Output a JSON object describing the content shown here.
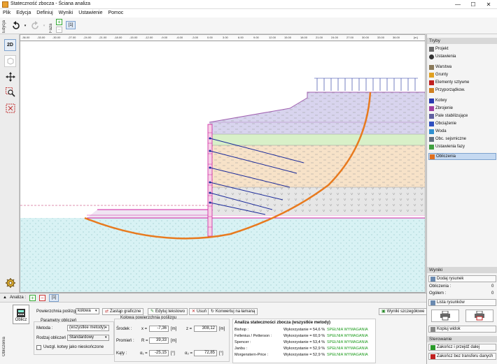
{
  "window": {
    "title": "Stateczność zbocza - Ściana analiza",
    "minimize": "—",
    "maximize": "☐",
    "close": "✕"
  },
  "menu": [
    "Plik",
    "Edycja",
    "Definiuj",
    "Wyniki",
    "Ustawienie",
    "Pomoc"
  ],
  "toolbar": {
    "edit_tab": "Edycja",
    "stage_tab": "Faza",
    "stage_label": "[1]"
  },
  "left_tools": {
    "view_2d": "2D"
  },
  "ruler": {
    "ticks": [
      "-36.00",
      "-33.00",
      "-30.00",
      "-27.00",
      "-24.00",
      "-21.00",
      "-18.00",
      "-15.00",
      "-12.00",
      "-9.00",
      "-6.00",
      "-3.00",
      "0.00",
      "3.00",
      "6.00",
      "9.00",
      "12.00",
      "15.00",
      "18.00",
      "21.00",
      "24.00",
      "27.00",
      "30.00",
      "33.00",
      "36.00",
      "[m]"
    ]
  },
  "modes": {
    "header": "Tryby",
    "items": [
      {
        "label": "Projekt",
        "icon": "project-icon",
        "color": "#6b6b6b"
      },
      {
        "label": "Ustawienia",
        "icon": "settings-icon",
        "color": "#333333"
      },
      {
        "label": "Warstwa",
        "icon": "layer-icon",
        "color": "#8a7a5a"
      },
      {
        "label": "Grunty",
        "icon": "soil-icon",
        "color": "#e0a020"
      },
      {
        "label": "Elementy sztywne",
        "icon": "rigid-icon",
        "color": "#c02020"
      },
      {
        "label": "Przyporządkow.",
        "icon": "assign-icon",
        "color": "#d08020"
      },
      {
        "label": "Kotwy",
        "icon": "anchor-icon",
        "color": "#2a3ab0"
      },
      {
        "label": "Zbrojenie",
        "icon": "reinforcement-icon",
        "color": "#a040a0"
      },
      {
        "label": "Pale stabilizujące",
        "icon": "pile-icon",
        "color": "#6060a0"
      },
      {
        "label": "Obciążenie",
        "icon": "load-icon",
        "color": "#3050c0"
      },
      {
        "label": "Woda",
        "icon": "water-icon",
        "color": "#3090d0"
      },
      {
        "label": "Obc. sejsmiczne",
        "icon": "seismic-icon",
        "color": "#607080"
      },
      {
        "label": "Ustawienia fazy",
        "icon": "stage-settings-icon",
        "color": "#40a040"
      },
      {
        "label": "Obliczenia",
        "icon": "analysis-icon",
        "color": "#e07020"
      }
    ]
  },
  "outputs": {
    "header": "Wyniki",
    "add_picture": "Dodaj rysunek",
    "analysis_label": "Obliczenia :",
    "analysis_value": "0",
    "total_label": "Ogółem :",
    "total_value": "0",
    "list_pictures": "Lista rysunków",
    "copy_view": "Kopiuj widok"
  },
  "control": {
    "header": "Sterowanie",
    "finish": "Zakończ i przejdź dalej",
    "finish_no_transfer": "Zakończ bez transferu danych"
  },
  "analysis_bar": {
    "label": "Analiza :",
    "tab": "[1]"
  },
  "bottom": {
    "side_tab": "Obliczenia",
    "compute_btn": "Oblicz",
    "surface_label": "Powierzchnia poślizgu :",
    "surface_value": "kołowa",
    "btn_graphic": "Zastąp graficzne",
    "btn_text": "Edytuj tekstowo",
    "btn_delete": "Usuń",
    "btn_convert": "Konwertuj na łamaną",
    "btn_details": "Wyniki szczegółowe",
    "params_title": "Parametry obliczeń",
    "method_label": "Metoda :",
    "method_value": "(wszystkie metody)",
    "type_label": "Rodzaj obliczeń :",
    "type_value": "Standardowy",
    "anchors_label": "Uwzgl. kotwy jako nieskończone",
    "circle_title": "Kołowa powierzchnia poślizgu",
    "center_label": "Środek :",
    "x_label": "x =",
    "x_value": "-7,36",
    "z_label": "z =",
    "z_value": "308,12",
    "unit_m": "[m]",
    "radius_label": "Promień :",
    "r_label": "R =",
    "r_value": "39,33",
    "angles_label": "Kąty :",
    "a1_label": "α₁ =",
    "a1_value": "-25,15",
    "a2_label": "α₂ =",
    "a2_value": "72,85",
    "unit_deg": "[°]"
  },
  "results": {
    "title": "Analiza stateczności zbocza (wszystkie metody)",
    "rows": [
      {
        "method": "Bishop :",
        "util": "Wykorzystanie = 54,6 %",
        "status": "SPEŁNIA WYMAGANIA"
      },
      {
        "method": "Fellenius / Petterson :",
        "util": "Wykorzystanie = 60,9 %",
        "status": "SPEŁNIA WYMAGANIA"
      },
      {
        "method": "Spencer :",
        "util": "Wykorzystanie = 53,4 %",
        "status": "SPEŁNIA WYMAGANIA"
      },
      {
        "method": "Janbu :",
        "util": "Wykorzystanie = 52,9 %",
        "status": "SPEŁNIA WYMAGANIA"
      },
      {
        "method": "Morgenstern-Price :",
        "util": "Wykorzystanie = 52,9 %",
        "status": "SPEŁNIA WYMAGANIA"
      }
    ]
  },
  "colors": {
    "accent_orange": "#e87a1e",
    "anchor_blue": "#1a2a9a",
    "pink_line": "#d020a0",
    "ok_green": "#1a9a1a",
    "soil_purple": "#d8d4ee",
    "soil_green": "#d8f0c8",
    "soil_tan": "#f7e2c8",
    "soil_grey": "#e6e6e6",
    "water_blue": "#d8f2f4"
  }
}
